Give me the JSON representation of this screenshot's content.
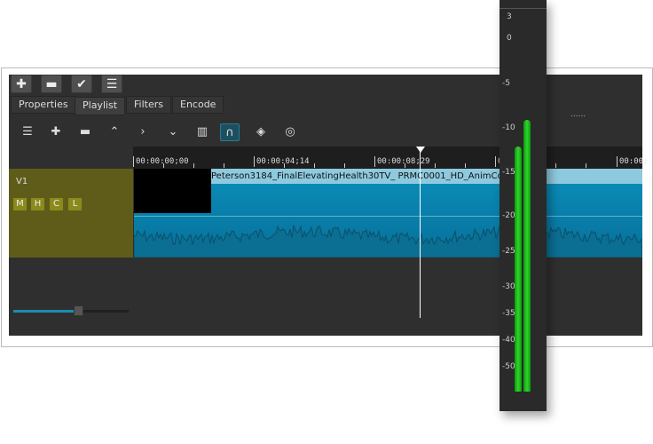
{
  "toolbar_top": [
    {
      "icon": "plus-icon",
      "glyph": "✚"
    },
    {
      "icon": "minus-icon",
      "glyph": "▬"
    },
    {
      "icon": "check-icon",
      "glyph": "✔"
    },
    {
      "icon": "menu-icon",
      "glyph": "☰"
    }
  ],
  "tabs": [
    {
      "label": "Properties"
    },
    {
      "label": "Playlist",
      "active": true
    },
    {
      "label": "Filters"
    },
    {
      "label": "Encode"
    }
  ],
  "timeline_toolbar": [
    {
      "icon": "menu-icon",
      "glyph": "☰"
    },
    {
      "icon": "append-icon",
      "glyph": "✚"
    },
    {
      "icon": "remove-icon",
      "glyph": "▬"
    },
    {
      "icon": "lift-icon",
      "glyph": "⌃"
    },
    {
      "icon": "overwrite-icon",
      "glyph": "›"
    },
    {
      "icon": "split-icon",
      "glyph": "⌄"
    },
    {
      "icon": "split-clip-icon",
      "glyph": "▥"
    },
    {
      "icon": "snap-magnet-icon",
      "glyph": "∩",
      "active": true
    },
    {
      "icon": "scrub-icon",
      "glyph": "◈"
    },
    {
      "icon": "ripple-icon",
      "glyph": "◎"
    }
  ],
  "ruler": [
    "00:00:00;00",
    "00:00:04;14",
    "00:00:08;29",
    "0",
    "00:00:"
  ],
  "track": {
    "name": "V1",
    "buttons": [
      "M",
      "H",
      "C",
      "L"
    ]
  },
  "clip": {
    "title": "Peterson3184_FinalElevatingHealth30TV_ PRMC0001_HD_AnimCod"
  },
  "dots": "......",
  "meter": {
    "labels": [
      "3",
      "0",
      "-5",
      "-10",
      "-15",
      "-20",
      "-25",
      "-30",
      "-35",
      "-40",
      "-50"
    ],
    "left_level_db": -12,
    "right_level_db": -9,
    "color": "#22c022"
  },
  "zoom_slider": {
    "value_percent": 56
  }
}
